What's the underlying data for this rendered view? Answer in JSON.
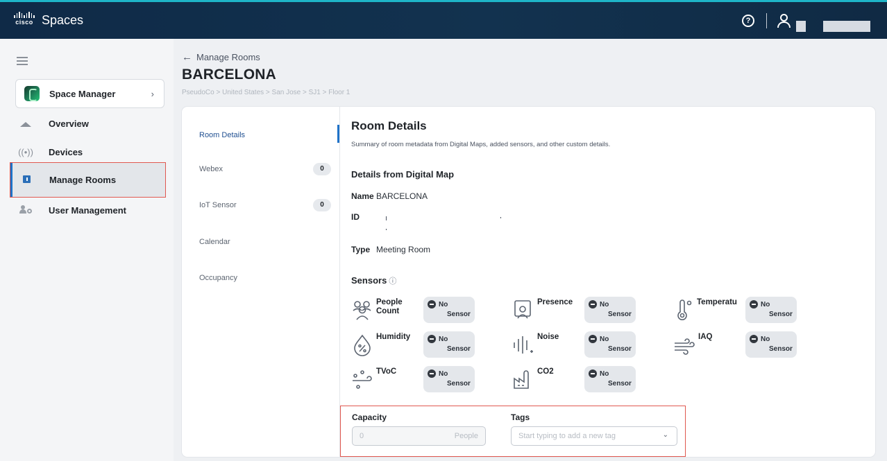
{
  "topbar": {
    "app_name": "Spaces",
    "logo_word": "cisco",
    "help_icon": "help-circle-icon",
    "user_icon": "user-icon"
  },
  "sidebar": {
    "app_switcher": {
      "label": "Space Manager",
      "chevron": "›"
    },
    "items": [
      {
        "label": "Overview",
        "icon": "home-icon"
      },
      {
        "label": "Devices",
        "icon": "signal-icon"
      },
      {
        "label": "Manage Rooms",
        "icon": "room-icon",
        "active": true
      },
      {
        "label": "User Management",
        "icon": "user-management-icon"
      }
    ]
  },
  "header": {
    "back_label": "Manage Rooms",
    "title": "BARCELONA",
    "breadcrumb": "PseudoCo > United States > San Jose > SJ1 > Floor 1"
  },
  "tabs": [
    {
      "label": "Room Details",
      "active": true
    },
    {
      "label": "Webex",
      "count": "0"
    },
    {
      "label": "IoT Sensor",
      "count": "0"
    },
    {
      "label": "Calendar"
    },
    {
      "label": "Occupancy"
    }
  ],
  "details": {
    "title": "Room Details",
    "description": "Summary of room metadata from Digital Maps, added sensors, and other custom details.",
    "digital_map_title": "Details from Digital Map",
    "name_label": "Name",
    "name_value": "BARCELONA",
    "id_label": "ID",
    "id_value": "",
    "type_label": "Type",
    "type_value": "Meeting Room",
    "sensors_title": "Sensors",
    "sensors_info_icon": "ⓘ"
  },
  "sensors": [
    {
      "label": "People Count",
      "line1": "People",
      "line2": "Count",
      "icon": "people-count-icon",
      "status_1": "No",
      "status_2": "Sensor"
    },
    {
      "label": "Presence",
      "line1": "Presence",
      "line2": "",
      "icon": "presence-icon",
      "status_1": "No",
      "status_2": "Sensor"
    },
    {
      "label": "Temperature",
      "line1": "Temperatu",
      "line2": "",
      "icon": "temperature-icon",
      "status_1": "No",
      "status_2": "Sensor"
    },
    {
      "label": "Humidity",
      "line1": "Humidity",
      "line2": "",
      "icon": "humidity-icon",
      "status_1": "No",
      "status_2": "Sensor"
    },
    {
      "label": "Noise",
      "line1": "Noise",
      "line2": "",
      "icon": "noise-icon",
      "status_1": "No",
      "status_2": "Sensor"
    },
    {
      "label": "IAQ",
      "line1": "IAQ",
      "line2": "",
      "icon": "iaq-icon",
      "status_1": "No",
      "status_2": "Sensor"
    },
    {
      "label": "TVoC",
      "line1": "TVoC",
      "line2": "",
      "icon": "tvoc-icon",
      "status_1": "No",
      "status_2": "Sensor"
    },
    {
      "label": "CO2",
      "line1": "CO2",
      "line2": "",
      "icon": "co2-icon",
      "status_1": "No",
      "status_2": "Sensor"
    }
  ],
  "capacity": {
    "label": "Capacity",
    "value": "0",
    "unit": "People"
  },
  "tags": {
    "label": "Tags",
    "placeholder": "Start typing to add a new tag"
  },
  "colors": {
    "accent": "#1f72c8",
    "highlight": "#e0574f",
    "topbar": "#0f2a47"
  }
}
